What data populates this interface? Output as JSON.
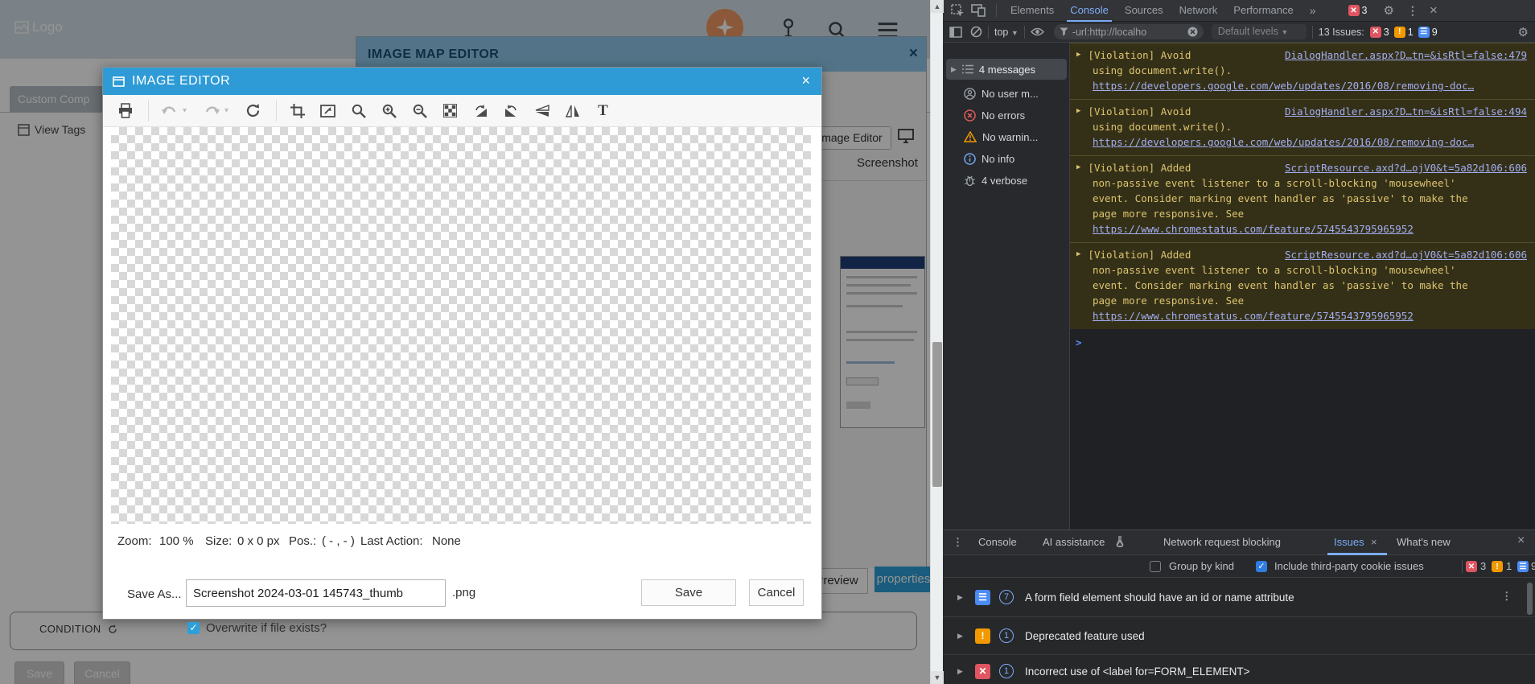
{
  "page": {
    "logo_text": "Logo",
    "tab_label": "Custom Comp",
    "view_tags_label": "View Tags",
    "condition_label": "CONDITION",
    "save_label": "Save",
    "cancel_label": "Cancel",
    "header_icons": [
      "sparkle-circle",
      "pin",
      "search",
      "menu"
    ]
  },
  "map_editor": {
    "title": "IMAGE MAP EDITOR",
    "close_label": "×",
    "image_editor_button": "Image Editor",
    "screenshot_label": "Screenshot",
    "preview_tab": "Preview",
    "properties_tab": "properties"
  },
  "image_editor": {
    "title": "IMAGE EDITOR",
    "close_label": "×",
    "toolbar_icons": [
      "print",
      "undo",
      "redo",
      "refresh",
      "crop",
      "resize",
      "zoom",
      "zoom-in",
      "zoom-out",
      "transparency",
      "rotate-right",
      "rotate-left",
      "flip-vertical",
      "flip-horizontal",
      "text"
    ],
    "text_tool_glyph": "T",
    "status": {
      "zoom_label": "Zoom:",
      "zoom_value": "100 %",
      "size_label": "Size:",
      "size_value": "0 x 0 px",
      "pos_label": "Pos.:",
      "pos_value": "( - , - )",
      "last_action_label": "Last Action:",
      "last_action_value": "None"
    },
    "save_as_label": "Save As...",
    "filename_value": "Screenshot 2024-03-01 145743_thumb",
    "extension": ".png",
    "overwrite_label": "Overwrite if file exists?",
    "save_label": "Save",
    "cancel_label": "Cancel"
  },
  "devtools": {
    "tabs": [
      "Elements",
      "Console",
      "Sources",
      "Network",
      "Performance"
    ],
    "active_tab": "Console",
    "more_tabs_glyph": "»",
    "error_badge_count": "3",
    "console_toolbar": {
      "context": "top",
      "filter_value": "-url:http://localho",
      "levels": "Default levels",
      "issues_label": "13 Issues:",
      "errors": "3",
      "warnings": "1",
      "infos": "9"
    },
    "sidebar": {
      "items": [
        {
          "label": "4 messages",
          "icon": "list"
        },
        {
          "label": "No user m...",
          "icon": "user"
        },
        {
          "label": "No errors",
          "icon": "error-circle"
        },
        {
          "label": "No warnin...",
          "icon": "warning-triangle"
        },
        {
          "label": "No info",
          "icon": "info-circle"
        },
        {
          "label": "4 verbose",
          "icon": "bug"
        }
      ]
    },
    "messages": [
      {
        "prefix": "[Violation] Avoid",
        "source": "DialogHandler.aspx?D…tn=&isRtl=false:479",
        "body": "using document.write().",
        "link": "https://developers.google.com/web/updates/2016/08/removing-doc…"
      },
      {
        "prefix": "[Violation] Avoid",
        "source": "DialogHandler.aspx?D…tn=&isRtl=false:494",
        "body": "using document.write().",
        "link": "https://developers.google.com/web/updates/2016/08/removing-doc…"
      },
      {
        "prefix": "[Violation] Added",
        "source": "ScriptResource.axd?d…ojV0&t=5a82d106:606",
        "body": "non-passive event listener to a scroll-blocking 'mousewheel' event. Consider marking event handler as 'passive' to make the page more responsive. See",
        "link": "https://www.chromestatus.com/feature/5745543795965952"
      },
      {
        "prefix": "[Violation] Added",
        "source": "ScriptResource.axd?d…ojV0&t=5a82d106:606",
        "body": "non-passive event listener to a scroll-blocking 'mousewheel' event. Consider marking event handler as 'passive' to make the page more responsive. See",
        "link": "https://www.chromestatus.com/feature/5745543795965952"
      }
    ],
    "prompt_glyph": ">",
    "drawer": {
      "tabs": [
        "Console",
        "AI assistance",
        "Network request blocking",
        "Issues",
        "What's new"
      ],
      "active_tab": "Issues",
      "tab_close_glyph": "×",
      "close_glyph": "×",
      "group_by_kind": "Group by kind",
      "include_third_party": "Include third-party cookie issues",
      "errors": "3",
      "warnings": "1",
      "infos": "9",
      "issues": [
        {
          "count": "7",
          "severity": "page",
          "text": "A form field element should have an id or name attribute"
        },
        {
          "count": "1",
          "severity": "warning",
          "text": "Deprecated feature used"
        },
        {
          "count": "1",
          "severity": "error",
          "text": "Incorrect use of <label for=FORM_ELEMENT>"
        }
      ]
    }
  },
  "colors": {
    "dialog_accent": "#2e9bd6",
    "devtools_accent": "#7cacf8",
    "violation_bg": "#343018",
    "violation_text": "#ddc46e",
    "error_red": "#e05561",
    "warning_orange": "#f29900",
    "info_blue": "#4c8bf5"
  }
}
